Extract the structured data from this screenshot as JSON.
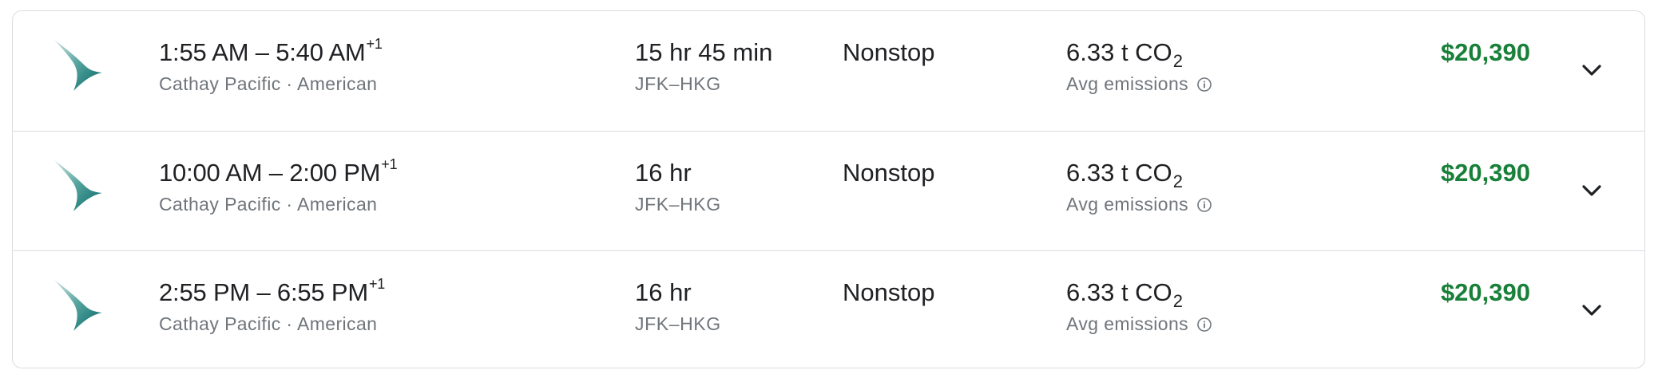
{
  "flights": [
    {
      "times": "1:55 AM – 5:40 AM",
      "day_offset": "+1",
      "airlines": "Cathay Pacific · American",
      "duration": "15 hr 45 min",
      "route": "JFK–HKG",
      "stops": "Nonstop",
      "emissions_value": "6.33 t CO",
      "emissions_sub": "2",
      "emissions_label": "Avg emissions",
      "price": "$20,390"
    },
    {
      "times": "10:00 AM – 2:00 PM",
      "day_offset": "+1",
      "airlines": "Cathay Pacific · American",
      "duration": "16 hr",
      "route": "JFK–HKG",
      "stops": "Nonstop",
      "emissions_value": "6.33 t CO",
      "emissions_sub": "2",
      "emissions_label": "Avg emissions",
      "price": "$20,390"
    },
    {
      "times": "2:55 PM – 6:55 PM",
      "day_offset": "+1",
      "airlines": "Cathay Pacific · American",
      "duration": "16 hr",
      "route": "JFK–HKG",
      "stops": "Nonstop",
      "emissions_value": "6.33 t CO",
      "emissions_sub": "2",
      "emissions_label": "Avg emissions",
      "price": "$20,390"
    }
  ],
  "icons": {
    "logo": "cathay-pacific-logo",
    "info": "info-icon",
    "expand": "chevron-down-icon"
  },
  "colors": {
    "price": "#188038",
    "logo": "#006564",
    "secondary_text": "#70757a",
    "border": "#dadce0"
  }
}
